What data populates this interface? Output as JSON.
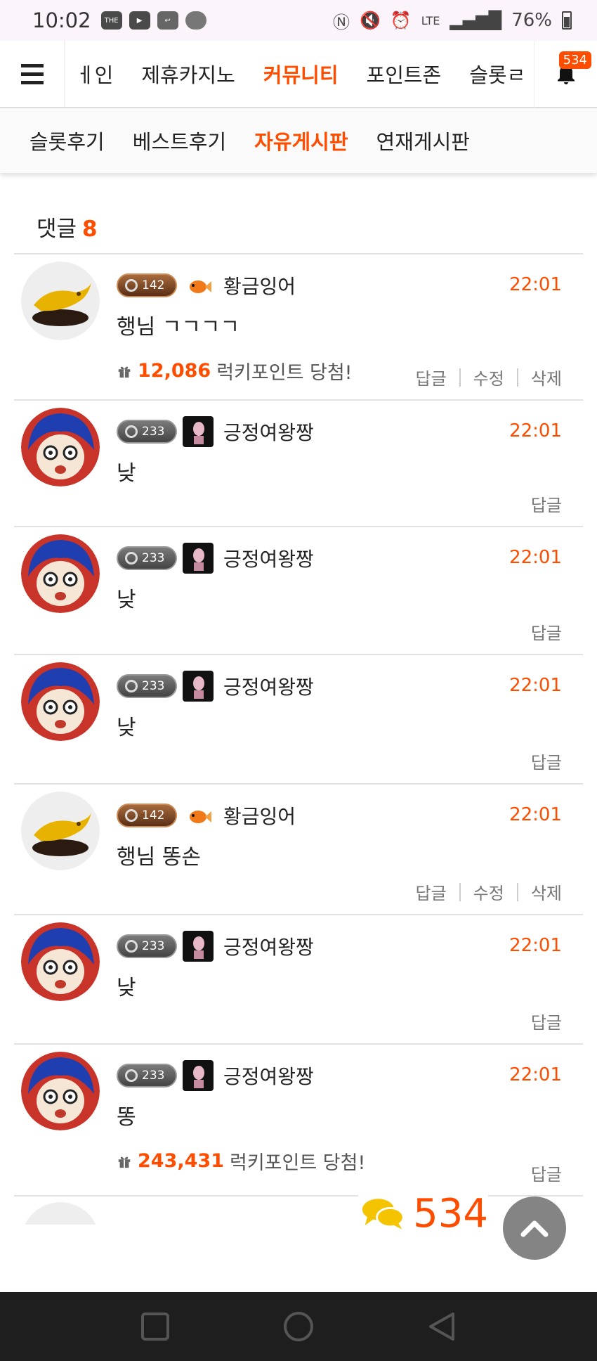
{
  "status_bar": {
    "time": "10:02",
    "left_icons": [
      "app-icon",
      "youtube-icon",
      "voicemail-icon",
      "cloud-icon"
    ],
    "network": "LTE",
    "battery": "76%"
  },
  "top_nav": {
    "items": [
      "메인",
      "제휴카지노",
      "커뮤니티",
      "포인트존",
      "슬롯리"
    ],
    "visible_items": [
      "ㅔ인",
      "제휴카지노",
      "커뮤니티",
      "포인트존",
      "슬롯ㄹ"
    ],
    "active_index": 2,
    "notification_count": "534"
  },
  "sub_nav": {
    "items": [
      "슬롯후기",
      "베스트후기",
      "자유게시판",
      "연재게시판"
    ],
    "active_index": 2
  },
  "comments_header": {
    "label": "댓글",
    "count": "8"
  },
  "comments": [
    {
      "avatar": "gold-fish",
      "level": "142",
      "level_style": "gold",
      "badge": "goldfish-icon",
      "nickname": "황금잉어",
      "time": "22:01",
      "text": "행님 ㄱㄱㄱㄱ",
      "lucky_amount": "12,086",
      "lucky_label": "럭키포인트 당첨!",
      "actions": [
        "답글",
        "수정",
        "삭제"
      ]
    },
    {
      "avatar": "cartoon-girl",
      "level": "233",
      "level_style": "silver",
      "badge": "dark-portrait-icon",
      "nickname": "긍정여왕짱",
      "time": "22:01",
      "text": "낮",
      "actions": [
        "답글"
      ]
    },
    {
      "avatar": "cartoon-girl",
      "level": "233",
      "level_style": "silver",
      "badge": "dark-portrait-icon",
      "nickname": "긍정여왕짱",
      "time": "22:01",
      "text": "낮",
      "actions": [
        "답글"
      ]
    },
    {
      "avatar": "cartoon-girl",
      "level": "233",
      "level_style": "silver",
      "badge": "dark-portrait-icon",
      "nickname": "긍정여왕짱",
      "time": "22:01",
      "text": "낮",
      "actions": [
        "답글"
      ]
    },
    {
      "avatar": "gold-fish",
      "level": "142",
      "level_style": "gold",
      "badge": "goldfish-icon",
      "nickname": "황금잉어",
      "time": "22:01",
      "text": "행님 똥손",
      "actions": [
        "답글",
        "수정",
        "삭제"
      ]
    },
    {
      "avatar": "cartoon-girl",
      "level": "233",
      "level_style": "silver",
      "badge": "dark-portrait-icon",
      "nickname": "긍정여왕짱",
      "time": "22:01",
      "text": "낮",
      "actions": [
        "답글"
      ]
    },
    {
      "avatar": "cartoon-girl",
      "level": "233",
      "level_style": "silver",
      "badge": "dark-portrait-icon",
      "nickname": "긍정여왕짱",
      "time": "22:01",
      "text": "똥",
      "lucky_amount": "243,431",
      "lucky_label": "럭키포인트 당첨!",
      "actions": [
        "답글"
      ]
    }
  ],
  "floating": {
    "comment_count": "534"
  },
  "colors": {
    "accent": "#ff4d00"
  }
}
